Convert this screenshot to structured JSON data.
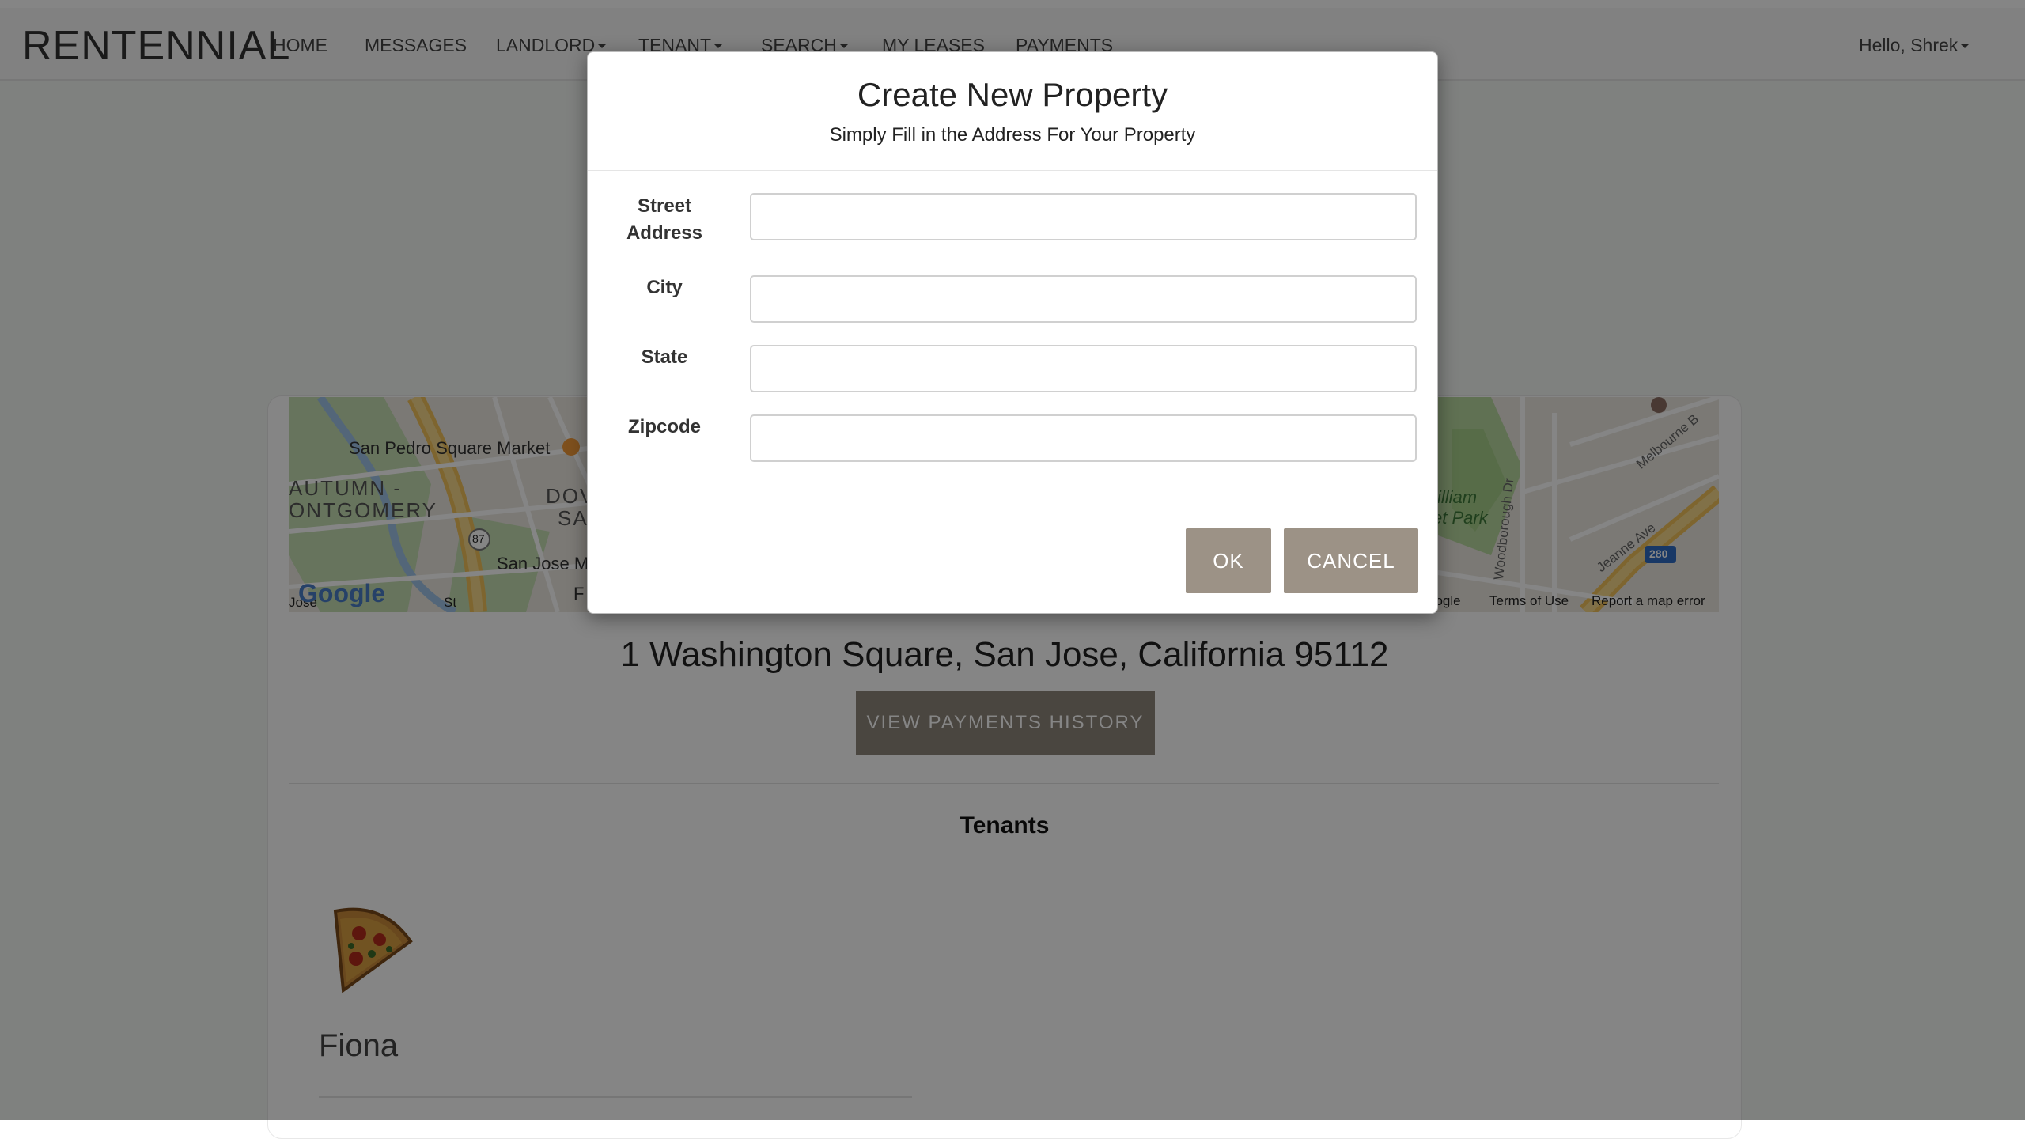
{
  "navbar": {
    "brand": "RENTENNIAL",
    "items": [
      {
        "label": "HOME"
      },
      {
        "label": "MESSAGES"
      },
      {
        "label": "LANDLORD"
      },
      {
        "label": "TENANT"
      },
      {
        "label": "SEARCH"
      },
      {
        "label": "MY LEASES"
      },
      {
        "label": "PAYMENTS"
      }
    ],
    "user_menu": "Hello, Shrek"
  },
  "map": {
    "labels": {
      "market": "San Pedro Square Market",
      "district1": "AUTUMN -",
      "district2": "ONTGOMERY",
      "downtown1": "DOV",
      "downtown2": "SA",
      "sanjose": "San Jose M",
      "f": "F",
      "route87": "87",
      "jose": "Jose",
      "st": "St",
      "park1": "illiam",
      "park2": "et Park",
      "woodborough": "Woodborough Dr",
      "melbourne": "Melbourne B",
      "jeanne": "Jeanne Ave",
      "interstate": "280"
    },
    "logo": "Google",
    "attribution": "oogle",
    "terms": "Terms of Use",
    "report": "Report a map error"
  },
  "property": {
    "address": "1 Washington Square, San Jose, California 95112",
    "payments_button": "VIEW PAYMENTS HISTORY",
    "tenants_title": "Tenants",
    "tenants": [
      {
        "name": "Fiona",
        "avatar": "pizza-icon"
      }
    ]
  },
  "modal": {
    "title": "Create New Property",
    "subtitle": "Simply Fill in the Address For Your Property",
    "fields": {
      "street_label_1": "Street",
      "street_label_2": "Address",
      "city_label": "City",
      "state_label": "State",
      "zip_label": "Zipcode"
    },
    "ok": "OK",
    "cancel": "CANCEL"
  }
}
